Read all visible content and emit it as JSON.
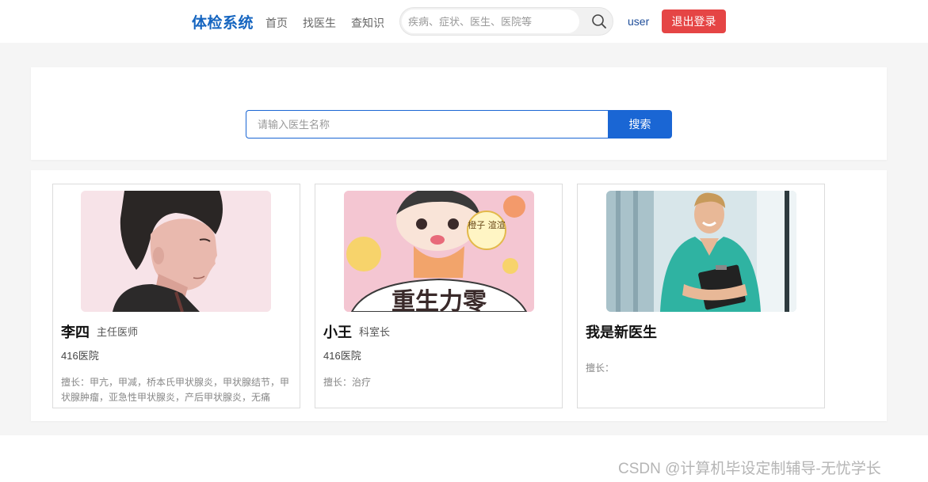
{
  "header": {
    "logo": "体检系统",
    "nav": [
      "首页",
      "找医生",
      "查知识"
    ],
    "search_placeholder": "疾病、症状、医生、医院等",
    "user": "user",
    "logout_label": "退出登录"
  },
  "doctor_search": {
    "placeholder": "请输入医生名称",
    "button_label": "搜索"
  },
  "doctors": [
    {
      "name": "李四",
      "title": "主任医师",
      "hospital": "416医院",
      "specialty": "擅长：甲亢，甲减，桥本氏甲状腺炎，甲状腺结节，甲状腺肿瘤，亚急性甲状腺炎，产后甲状腺炎，无痛"
    },
    {
      "name": "小王",
      "title": "科室长",
      "hospital": "416医院",
      "specialty": "擅长：治疗"
    },
    {
      "name": "我是新医生",
      "title": "",
      "hospital": "",
      "specialty": "擅长："
    }
  ],
  "photo_texts": {
    "sticker": "橙子\n渲渲",
    "banner": "重生力零"
  },
  "watermark": "CSDN @计算机毕设定制辅导-无忧学长",
  "colors": {
    "brand": "#1565c0",
    "primary_button": "#1a66d4",
    "logout_button": "#e54545",
    "page_bg": "#f5f5f5"
  }
}
